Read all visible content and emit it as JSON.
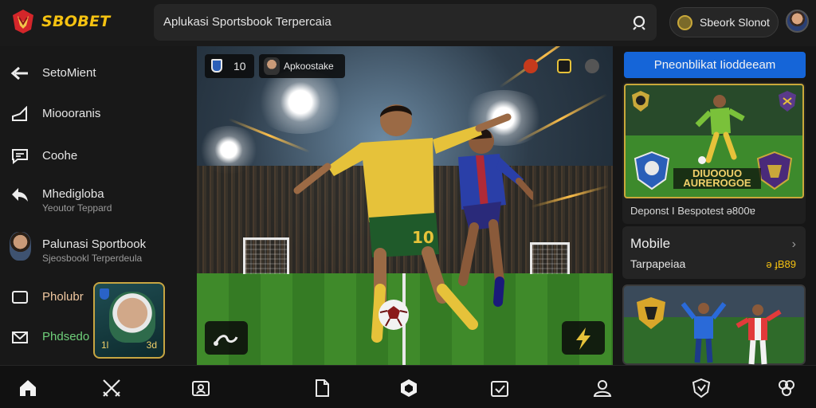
{
  "header": {
    "brand": "SBOBET",
    "search_text": "Aplukasi Sportsbook Terpercaia",
    "account_label": "Sbeork Slonot"
  },
  "sidebar": {
    "items": [
      {
        "label": "SetoMient",
        "icon": "arrow-left-icon"
      },
      {
        "label": "Mioooranis",
        "icon": "megaphone-icon"
      },
      {
        "label": "Coohe",
        "icon": "chat-icon"
      },
      {
        "label": "Mhedigloba",
        "sublabel": "Yeoutor Teppard",
        "icon": "share-icon"
      },
      {
        "label": "Palunasi Sportbook",
        "sublabel": "Sjeosbookl Terperdeula",
        "icon": "avatar"
      },
      {
        "label": "Pholubr",
        "icon": "monitor-icon"
      },
      {
        "label": "Phdsedo",
        "icon": "mail-icon"
      }
    ],
    "promo": {
      "left_value": "1l",
      "right_value": "3d"
    }
  },
  "hero": {
    "chip_score": "10",
    "chip_label": "Apkoostake",
    "player_number": "10"
  },
  "rail": {
    "button_label": "Pneonblikat Iioddeeam",
    "card1": {
      "banner_line1": "DIUOOUO",
      "banner_line2": "AUREROGOE",
      "caption": "Deponst I Bespotest ǝ800ɐ"
    },
    "card2": {
      "title": "Mobile",
      "subtitle": "Tarpapeiaa",
      "price": "ǝ ɟB89"
    }
  },
  "colors": {
    "brand_gold": "#f5c211",
    "brand_red": "#d4262a",
    "primary_blue": "#1565d8",
    "jersey_yellow": "#e6c23a",
    "jersey_blue": "#2a3fa8"
  },
  "bottom_nav": [
    {
      "icon": "home-icon"
    },
    {
      "icon": "crossed-swords-icon"
    },
    {
      "icon": "profile-card-icon"
    },
    {
      "icon": "document-icon"
    },
    {
      "icon": "hexagon-icon"
    },
    {
      "icon": "calendar-check-icon"
    },
    {
      "icon": "user-icon"
    },
    {
      "icon": "shield-heart-icon"
    },
    {
      "icon": "support-icon"
    }
  ]
}
